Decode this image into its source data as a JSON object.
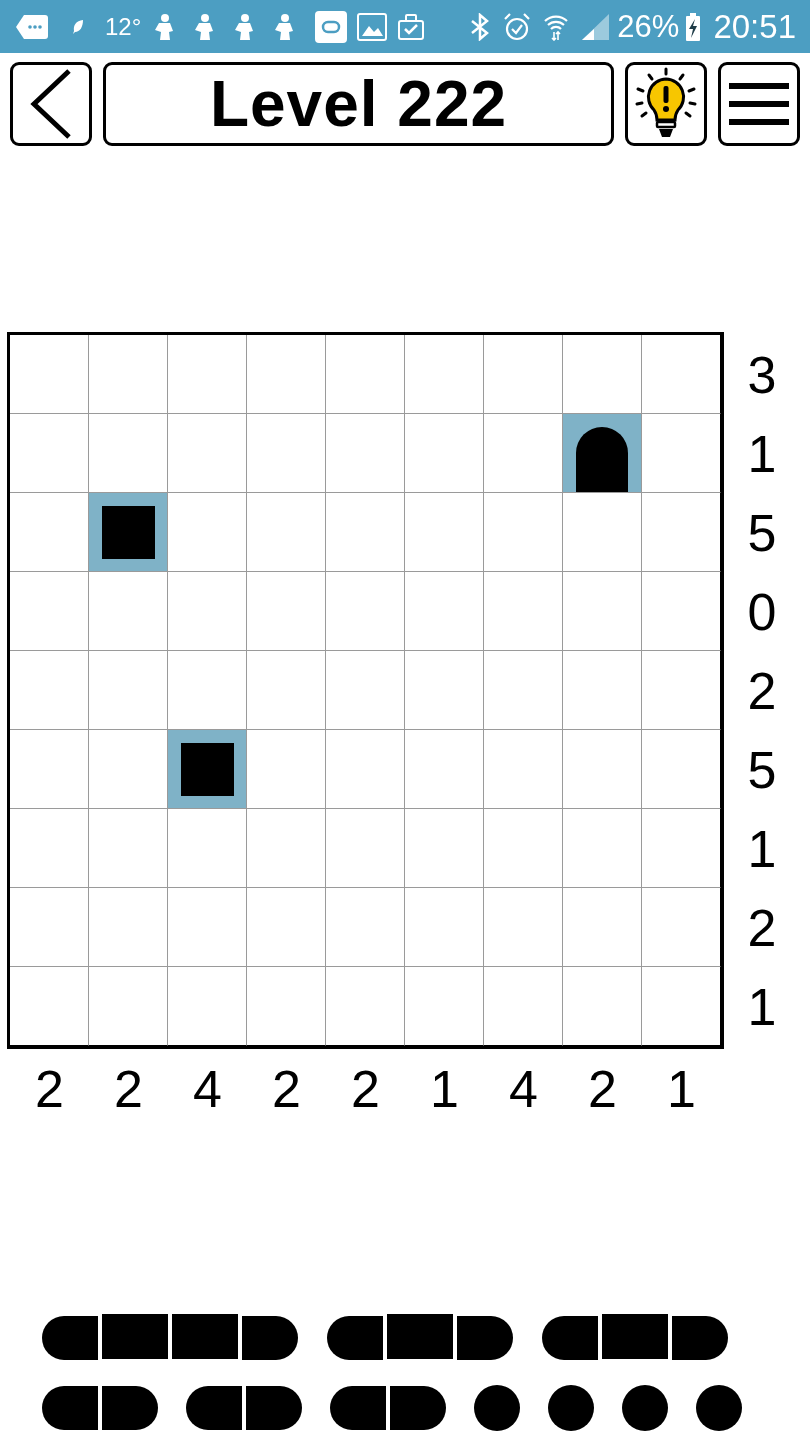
{
  "status_bar": {
    "temperature": "12°",
    "battery": "26%",
    "time": "20:51"
  },
  "header": {
    "title": "Level 222"
  },
  "board": {
    "rows": [
      {
        "clue": "3",
        "cells": [
          {
            "kind": "blank"
          },
          {
            "kind": "blank"
          },
          {
            "kind": "blank"
          },
          {
            "kind": "blank"
          },
          {
            "kind": "blank"
          },
          {
            "kind": "blank"
          },
          {
            "kind": "blank"
          },
          {
            "kind": "blank"
          },
          {
            "kind": "blank"
          }
        ]
      },
      {
        "clue": "1",
        "cells": [
          {
            "kind": "blank"
          },
          {
            "kind": "blank"
          },
          {
            "kind": "blank"
          },
          {
            "kind": "blank"
          },
          {
            "kind": "blank"
          },
          {
            "kind": "blank"
          },
          {
            "kind": "blank"
          },
          {
            "kind": "top"
          },
          {
            "kind": "blank"
          }
        ]
      },
      {
        "clue": "5",
        "cells": [
          {
            "kind": "blank"
          },
          {
            "kind": "middle"
          },
          {
            "kind": "blank"
          },
          {
            "kind": "blank"
          },
          {
            "kind": "blank"
          },
          {
            "kind": "blank"
          },
          {
            "kind": "blank"
          },
          {
            "kind": "blank"
          },
          {
            "kind": "blank"
          }
        ]
      },
      {
        "clue": "0",
        "cells": [
          {
            "kind": "blank"
          },
          {
            "kind": "blank"
          },
          {
            "kind": "blank"
          },
          {
            "kind": "blank"
          },
          {
            "kind": "blank"
          },
          {
            "kind": "blank"
          },
          {
            "kind": "blank"
          },
          {
            "kind": "blank"
          },
          {
            "kind": "blank"
          }
        ]
      },
      {
        "clue": "2",
        "cells": [
          {
            "kind": "blank"
          },
          {
            "kind": "blank"
          },
          {
            "kind": "blank"
          },
          {
            "kind": "blank"
          },
          {
            "kind": "blank"
          },
          {
            "kind": "blank"
          },
          {
            "kind": "blank"
          },
          {
            "kind": "blank"
          },
          {
            "kind": "blank"
          }
        ]
      },
      {
        "clue": "5",
        "cells": [
          {
            "kind": "blank"
          },
          {
            "kind": "blank"
          },
          {
            "kind": "middle"
          },
          {
            "kind": "blank"
          },
          {
            "kind": "blank"
          },
          {
            "kind": "blank"
          },
          {
            "kind": "blank"
          },
          {
            "kind": "blank"
          },
          {
            "kind": "blank"
          }
        ]
      },
      {
        "clue": "1",
        "cells": [
          {
            "kind": "blank"
          },
          {
            "kind": "blank"
          },
          {
            "kind": "blank"
          },
          {
            "kind": "blank"
          },
          {
            "kind": "blank"
          },
          {
            "kind": "blank"
          },
          {
            "kind": "blank"
          },
          {
            "kind": "blank"
          },
          {
            "kind": "blank"
          }
        ]
      },
      {
        "clue": "2",
        "cells": [
          {
            "kind": "blank"
          },
          {
            "kind": "blank"
          },
          {
            "kind": "blank"
          },
          {
            "kind": "blank"
          },
          {
            "kind": "blank"
          },
          {
            "kind": "blank"
          },
          {
            "kind": "blank"
          },
          {
            "kind": "blank"
          },
          {
            "kind": "blank"
          }
        ]
      },
      {
        "clue": "1",
        "cells": [
          {
            "kind": "blank"
          },
          {
            "kind": "blank"
          },
          {
            "kind": "blank"
          },
          {
            "kind": "blank"
          },
          {
            "kind": "blank"
          },
          {
            "kind": "blank"
          },
          {
            "kind": "blank"
          },
          {
            "kind": "blank"
          },
          {
            "kind": "blank"
          }
        ]
      }
    ],
    "column_clues": [
      "2",
      "2",
      "4",
      "2",
      "2",
      "1",
      "4",
      "2",
      "1"
    ]
  },
  "fleet": [
    {
      "ships": [
        {
          "segments": [
            {
              "kind": "left"
            },
            {
              "kind": "middle"
            },
            {
              "kind": "middle"
            },
            {
              "kind": "right"
            }
          ]
        },
        {
          "segments": [
            {
              "kind": "left"
            },
            {
              "kind": "middle"
            },
            {
              "kind": "right"
            }
          ]
        },
        {
          "segments": [
            {
              "kind": "left"
            },
            {
              "kind": "middle"
            },
            {
              "kind": "right"
            }
          ]
        }
      ]
    },
    {
      "ships": [
        {
          "segments": [
            {
              "kind": "left"
            },
            {
              "kind": "right"
            }
          ]
        },
        {
          "segments": [
            {
              "kind": "left"
            },
            {
              "kind": "right"
            }
          ]
        },
        {
          "segments": [
            {
              "kind": "left"
            },
            {
              "kind": "right"
            }
          ]
        },
        {
          "segments": [
            {
              "kind": "single"
            }
          ]
        },
        {
          "segments": [
            {
              "kind": "single"
            }
          ]
        },
        {
          "segments": [
            {
              "kind": "single"
            }
          ]
        },
        {
          "segments": [
            {
              "kind": "single"
            }
          ]
        }
      ]
    }
  ]
}
